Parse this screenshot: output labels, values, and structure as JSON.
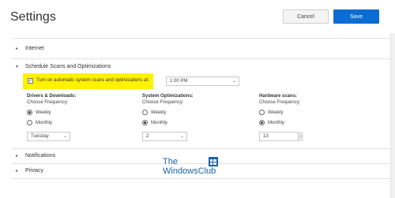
{
  "header": {
    "title": "Settings",
    "cancel_label": "Cancel",
    "save_label": "Save"
  },
  "sections": {
    "internet": "Internet",
    "schedule": "Schedule Scans and Optimizations",
    "notifications": "Notifications",
    "privacy": "Privacy"
  },
  "schedule": {
    "auto_label": "Turn on automatic system scans and optimizations at:",
    "time": "1:00 PM",
    "columns": [
      {
        "title": "Drivers & Downloads:",
        "sub": "Choose Frequency:",
        "opt1": "Weekly",
        "opt2": "Monthly",
        "selected": "Weekly",
        "value": "Tuesday"
      },
      {
        "title": "System Optimizations:",
        "sub": "Choose Frequency:",
        "opt1": "Weekly",
        "opt2": "Monthly",
        "selected": "Monthly",
        "value": "2"
      },
      {
        "title": "Hardware scans:",
        "sub": "Choose Frequency:",
        "opt1": "Weekly",
        "opt2": "Monthly",
        "selected": "Monthly",
        "value": "13"
      }
    ]
  },
  "watermark": {
    "line1": "The",
    "line2": "WindowsClub"
  },
  "colors": {
    "accent": "#0b6dd3",
    "highlight": "#fff200",
    "watermark": "#1b63a8"
  }
}
